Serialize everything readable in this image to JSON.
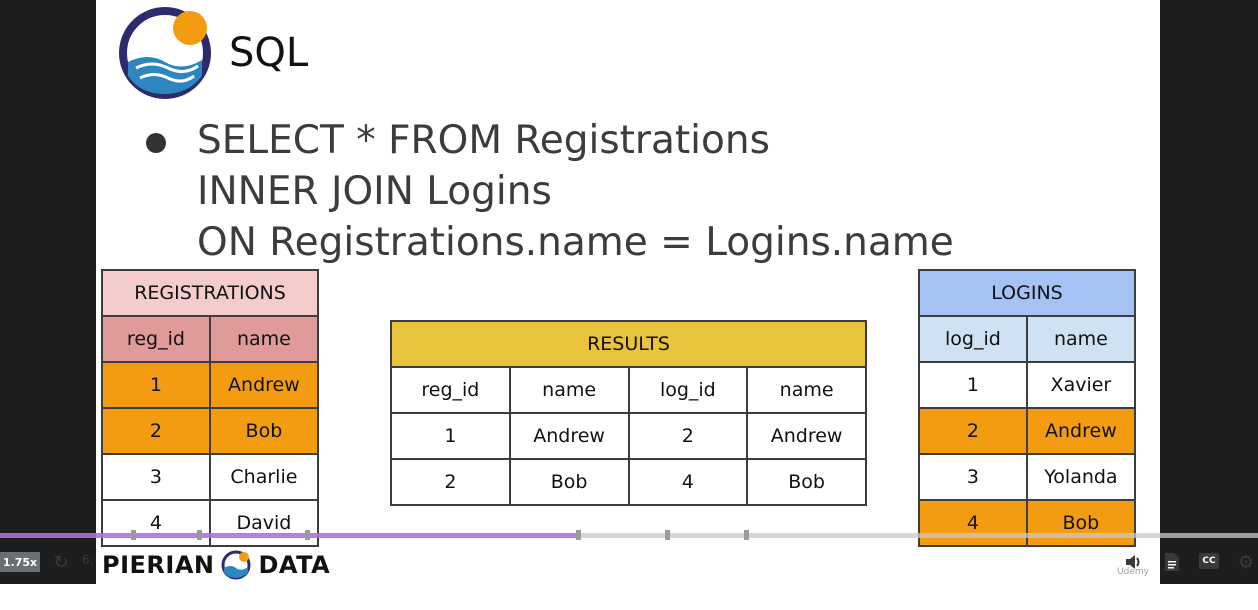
{
  "slide": {
    "title": "SQL",
    "query_lines": [
      "SELECT * FROM Registrations",
      "INNER JOIN Logins",
      "ON Registrations.name = Logins.name"
    ],
    "brand_left": "PIERIAN",
    "brand_right": "DATA"
  },
  "registrations": {
    "title": "REGISTRATIONS",
    "columns": [
      "reg_id",
      "name"
    ],
    "rows": [
      [
        "1",
        "Andrew"
      ],
      [
        "2",
        "Bob"
      ],
      [
        "3",
        "Charlie"
      ],
      [
        "4",
        "David"
      ]
    ],
    "highlighted_rows": [
      0,
      1
    ]
  },
  "results": {
    "title": "RESULTS",
    "columns": [
      "reg_id",
      "name",
      "log_id",
      "name"
    ],
    "rows": [
      [
        "1",
        "Andrew",
        "2",
        "Andrew"
      ],
      [
        "2",
        "Bob",
        "4",
        "Bob"
      ]
    ]
  },
  "logins": {
    "title": "LOGINS",
    "columns": [
      "log_id",
      "name"
    ],
    "rows": [
      [
        "1",
        "Xavier"
      ],
      [
        "2",
        "Andrew"
      ],
      [
        "3",
        "Yolanda"
      ],
      [
        "4",
        "Bob"
      ]
    ],
    "highlighted_rows": [
      1,
      3
    ]
  },
  "player": {
    "speed": "1.75x",
    "time": "6:",
    "watermark": "Udemy",
    "cc_label": "CC",
    "progress_fraction": 0.46,
    "colors": {
      "progress": "#a435f0",
      "highlight": "#f39c12"
    },
    "icons": [
      "rewind-icon",
      "volume-icon",
      "transcript-icon",
      "captions-icon",
      "settings-icon"
    ]
  }
}
